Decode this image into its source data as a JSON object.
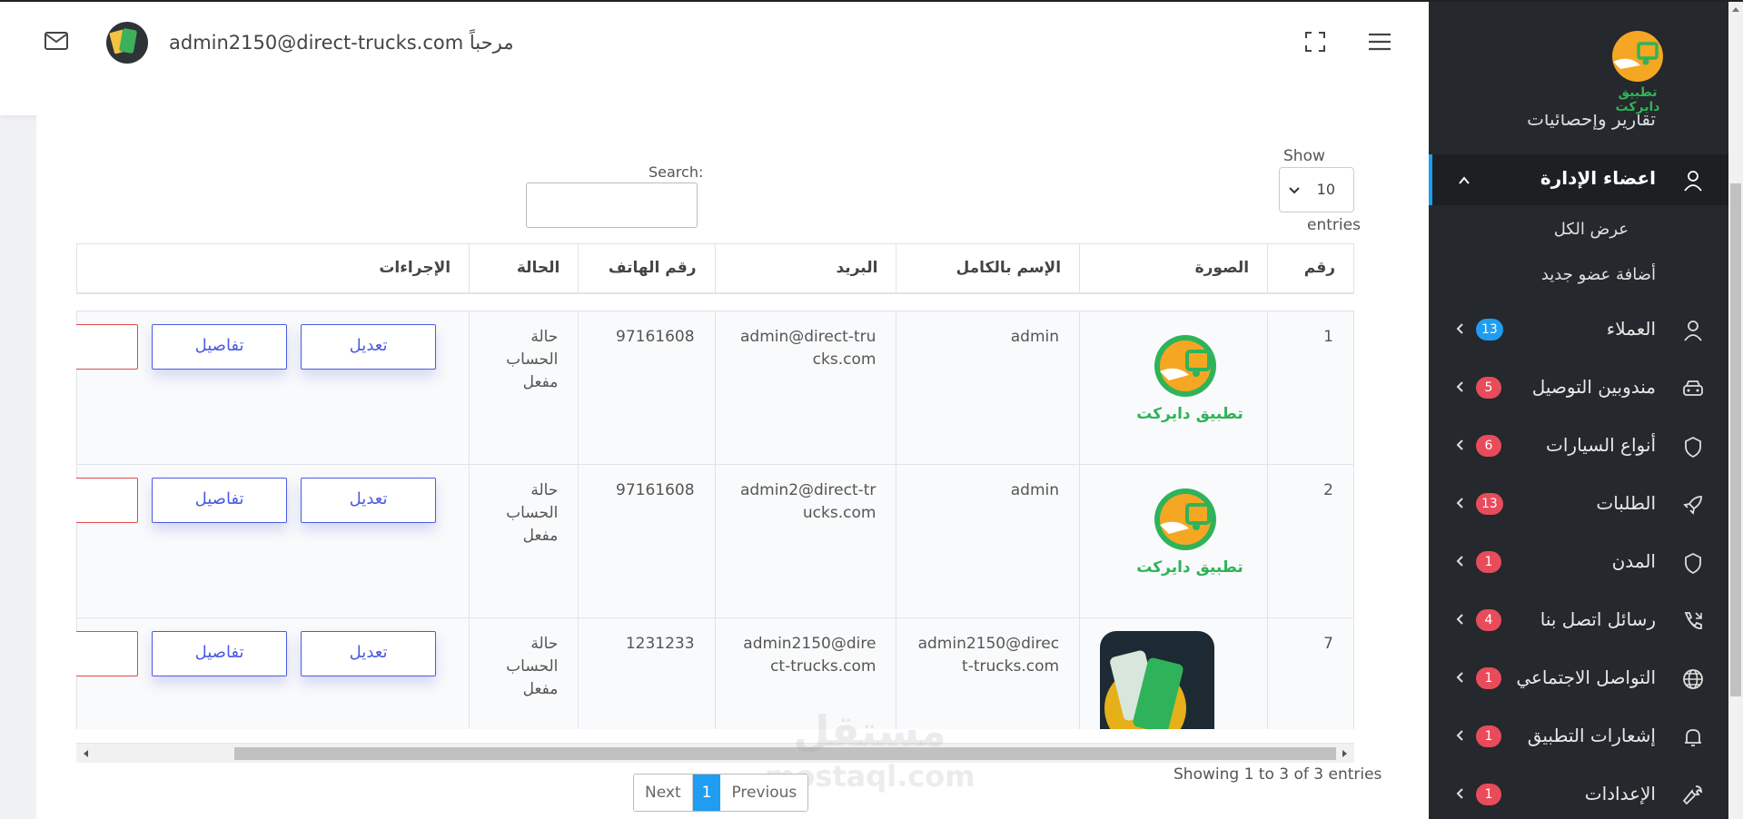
{
  "header": {
    "welcome_text": "admin2150@direct-trucks.com مرحباً"
  },
  "datatable": {
    "show_label": "Show",
    "page_length": "10",
    "entries_label": "entries",
    "search_label": "Search:",
    "search_value": "",
    "columns": [
      "رقم",
      "الصورة",
      "الإسم بالكامل",
      "البريد",
      "رقم الهاتف",
      "الحالة",
      "الإجراءات"
    ],
    "rows": [
      {
        "num": "1",
        "name": "admin",
        "email": "admin@direct-trucks.com",
        "phone": "97161608",
        "status": "حالة الحساب مفعل",
        "image": "تطبيق دايركت"
      },
      {
        "num": "2",
        "name": "admin",
        "email": "admin2@direct-trucks.com",
        "phone": "97161608",
        "status": "حالة الحساب مفعل",
        "image": "تطبيق دايركت"
      },
      {
        "num": "7",
        "name": "admin2150@direct-trucks.com",
        "email": "admin2150@direct-trucks.com",
        "phone": "1231233",
        "status": "حالة الحساب مفعل",
        "image": "app-screenshot"
      }
    ],
    "edit_label": "تعديل",
    "details_label": "تفاصيل",
    "showing_text": "Showing 1 to 3 of 3 entries",
    "pager": {
      "previous": "Previous",
      "current": "1",
      "next": "Next"
    }
  },
  "watermark": {
    "ar": "مستقل",
    "en": "mostaql.com"
  },
  "sidebar": {
    "logo_text": "تطبيق دايركت",
    "cut_item": "تقارير وإحصائيات",
    "active_item": "اعضاء الإدارة",
    "sub_items": [
      "عرض الكل",
      "أضافة عضو جديد"
    ],
    "items": [
      {
        "label": "العملاء",
        "badge": "13",
        "icon": "user-icon",
        "badge_color": "#1e9df1"
      },
      {
        "label": "مندوبين التوصيل",
        "badge": "5",
        "icon": "car-icon",
        "badge_color": "#e84c5b"
      },
      {
        "label": "أنواع السيارات",
        "badge": "6",
        "icon": "shield-icon",
        "badge_color": "#e84c5b"
      },
      {
        "label": "الطلبات",
        "badge": "13",
        "icon": "rocket-icon",
        "badge_color": "#e84c5b"
      },
      {
        "label": "المدن",
        "badge": "1",
        "icon": "shield-icon",
        "badge_color": "#e84c5b"
      },
      {
        "label": "رسائل اتصل بنا",
        "badge": "4",
        "icon": "phone-icon",
        "badge_color": "#e84c5b"
      },
      {
        "label": "التواصل الاجتماعي",
        "badge": "1",
        "icon": "globe-icon",
        "badge_color": "#e84c5b"
      },
      {
        "label": "إشعارات التطبيق",
        "badge": "1",
        "icon": "bell-icon",
        "badge_color": "#e84c5b"
      },
      {
        "label": "الإعدادات",
        "badge": "1",
        "icon": "wrench-icon",
        "badge_color": "#e84c5b"
      }
    ]
  },
  "colors": {
    "accent": "#1e9df1",
    "button": "#4a5be0",
    "danger": "#e84c5b",
    "sidebar_bg": "#25282c",
    "brand_green": "#2fb35a",
    "brand_orange": "#f5a623"
  }
}
